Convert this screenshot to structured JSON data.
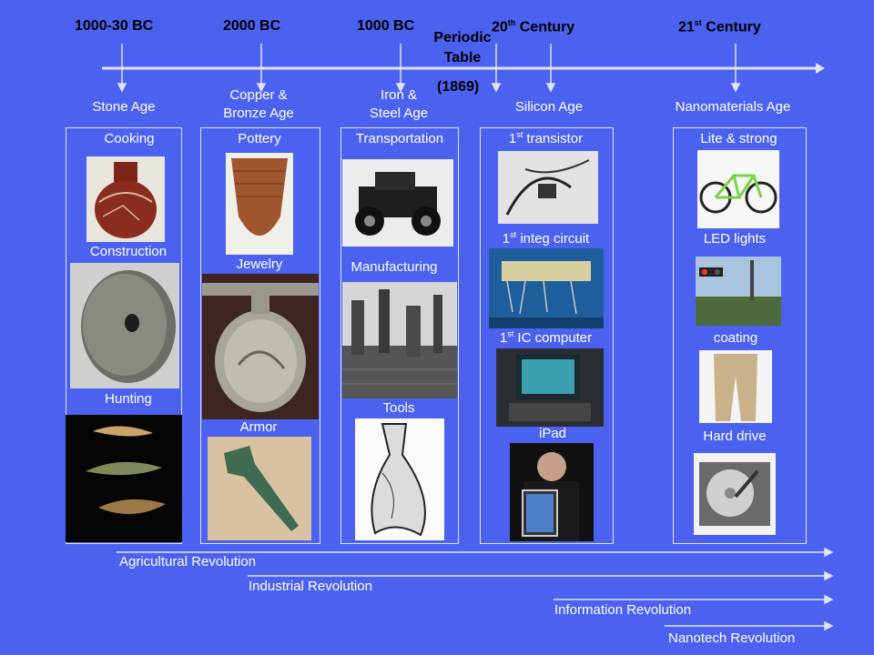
{
  "timeline": {
    "periods": [
      {
        "label": "1000-30 BC"
      },
      {
        "label": "2000 BC"
      },
      {
        "label": "1000 BC"
      },
      {
        "label": "20",
        "sup": "th",
        "rest": " Century"
      },
      {
        "label": "21",
        "sup": "st",
        "rest": " Century"
      }
    ],
    "periodic_table": {
      "line1": "Periodic",
      "line2": "Table",
      "year": "(1869)"
    }
  },
  "ages": [
    {
      "line1": "Stone Age"
    },
    {
      "line1": "Copper &",
      "line2": "Bronze Age"
    },
    {
      "line1": "Iron &",
      "line2": "Steel Age"
    },
    {
      "line1": "Silicon Age"
    },
    {
      "line1": "Nanomaterials Age"
    }
  ],
  "columns": {
    "stone": {
      "items": [
        "Cooking",
        "Construction",
        "Hunting"
      ]
    },
    "bronze": {
      "items": [
        "Pottery",
        "Jewelry",
        "Armor"
      ]
    },
    "iron": {
      "items": [
        "Transportation",
        "Manufacturing",
        "Tools"
      ]
    },
    "silicon": {
      "item1_pre": "1",
      "item1_sup": "st",
      "item1_post": " transistor",
      "item2_pre": "1",
      "item2_sup": "st",
      "item2_post": " integ circuit",
      "item3_pre": "1",
      "item3_sup": "st",
      "item3_post": " IC computer",
      "item4": "iPad"
    },
    "nano": {
      "items": [
        "Lite & strong",
        "LED lights",
        "coating",
        "Hard drive"
      ]
    }
  },
  "revolutions": [
    "Agricultural Revolution",
    "Industrial Revolution",
    "Information Revolution",
    "Nanotech Revolution"
  ],
  "colors": {
    "background": "#4b62f0",
    "period_text": "#000000",
    "text": "#ffffff"
  }
}
